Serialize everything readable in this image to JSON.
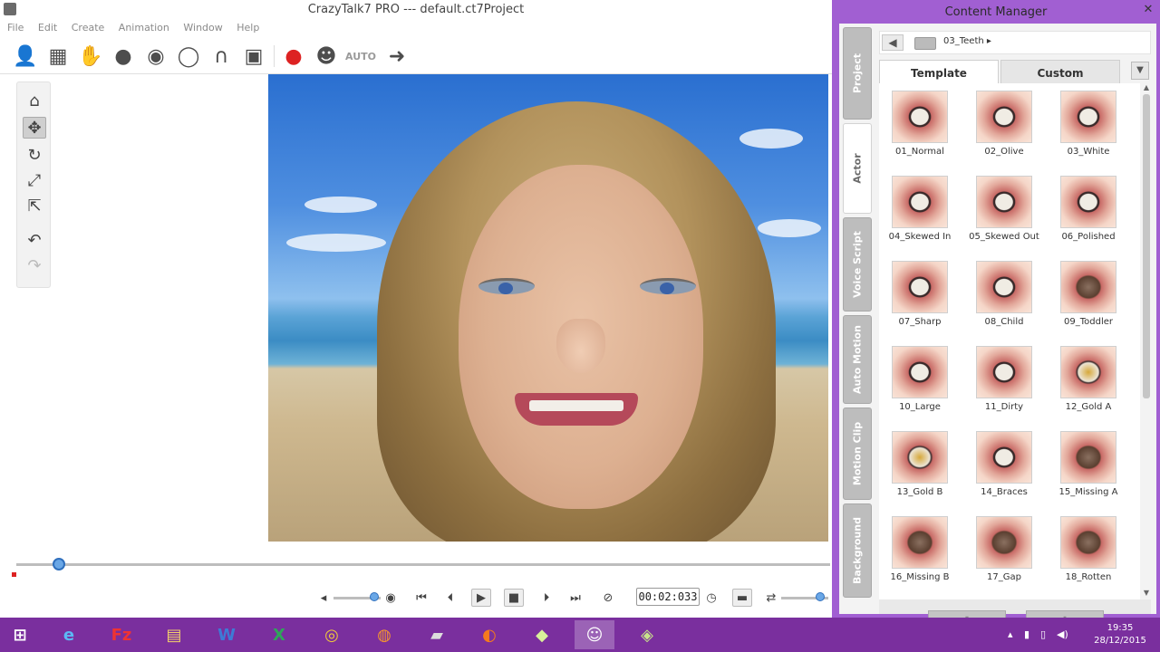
{
  "window": {
    "title": "CrazyTalk7 PRO --- default.ct7Project"
  },
  "menu": [
    "File",
    "Edit",
    "Create",
    "Animation",
    "Window",
    "Help"
  ],
  "toolbar": {
    "icons": [
      "actor-icon",
      "face-fitting-icon",
      "tracking-icon",
      "head-icon",
      "eye-icon",
      "mouth-icon",
      "teeth-icon",
      "image-icon",
      "voice-record-icon",
      "puppet-icon",
      "auto-motion-icon",
      "export-icon"
    ],
    "auto_label": "AUTO"
  },
  "side_tools": [
    "home-icon",
    "move-icon",
    "rotate-icon",
    "scale-icon",
    "fit-icon",
    "undo-icon",
    "redo-icon"
  ],
  "timeline": {
    "timecode": "00:02:033"
  },
  "content_manager": {
    "title": "Content Manager",
    "breadcrumb": "03_Teeth ▸",
    "tabs": {
      "template": "Template",
      "custom": "Custom"
    },
    "side_tabs": [
      "Project",
      "Actor",
      "Voice Script",
      "Auto Motion",
      "Motion Clip",
      "Background"
    ],
    "items": [
      {
        "label": "01_Normal",
        "style": "normal"
      },
      {
        "label": "02_Olive",
        "style": "normal"
      },
      {
        "label": "03_White",
        "style": "normal"
      },
      {
        "label": "04_Skewed In",
        "style": "normal"
      },
      {
        "label": "05_Skewed Out",
        "style": "normal"
      },
      {
        "label": "06_Polished",
        "style": "normal"
      },
      {
        "label": "07_Sharp",
        "style": "normal"
      },
      {
        "label": "08_Child",
        "style": "normal"
      },
      {
        "label": "09_Toddler",
        "style": "dark"
      },
      {
        "label": "10_Large",
        "style": "normal"
      },
      {
        "label": "11_Dirty",
        "style": "normal"
      },
      {
        "label": "12_Gold A",
        "style": "gold"
      },
      {
        "label": "13_Gold B",
        "style": "gold"
      },
      {
        "label": "14_Braces",
        "style": "normal"
      },
      {
        "label": "15_Missing A",
        "style": "dark"
      },
      {
        "label": "16_Missing B",
        "style": "dark"
      },
      {
        "label": "17_Gap",
        "style": "dark"
      },
      {
        "label": "18_Rotten",
        "style": "dark"
      }
    ]
  },
  "taskbar": {
    "apps": [
      "windows-start-icon",
      "internet-explorer-icon",
      "filezilla-icon",
      "file-explorer-icon",
      "word-icon",
      "excel-icon",
      "chrome-icon",
      "blender-icon",
      "camera-app-icon",
      "firefox-icon",
      "game-app-icon",
      "crazytalk-icon",
      "media-app-icon"
    ],
    "time": "19:35",
    "date": "28/12/2015"
  }
}
